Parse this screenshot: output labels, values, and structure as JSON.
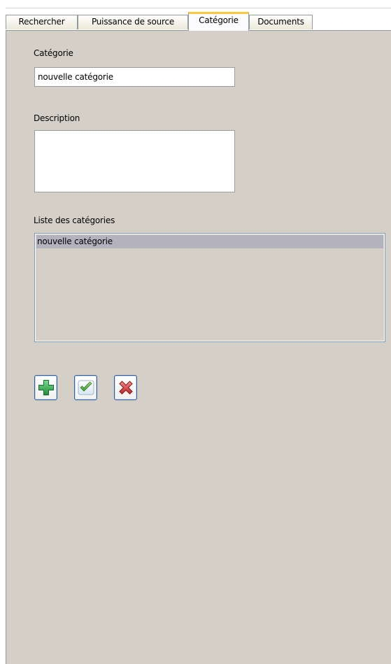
{
  "tabs": [
    {
      "label": "Rechercher"
    },
    {
      "label": "Puissance de source"
    },
    {
      "label": "Catégorie"
    },
    {
      "label": "Documents"
    }
  ],
  "active_tab": "Catégorie",
  "form": {
    "category_label": "Catégorie",
    "category_value": "nouvelle catégorie",
    "description_label": "Description",
    "description_value": "",
    "list_label": "Liste des catégories",
    "list_items": [
      "nouvelle catégorie"
    ],
    "selected_item": "nouvelle catégorie"
  },
  "buttons": {
    "add_icon": "plus-icon",
    "validate_icon": "checkmark-icon",
    "delete_icon": "x-icon"
  },
  "colors": {
    "panel_background": "#d4d0c8",
    "active_tab_accent": "#ffc83c",
    "selected_row": "#b3b2be",
    "add_green": "#2fa84f",
    "check_green": "#5fb84a",
    "delete_red": "#d83a3a"
  }
}
